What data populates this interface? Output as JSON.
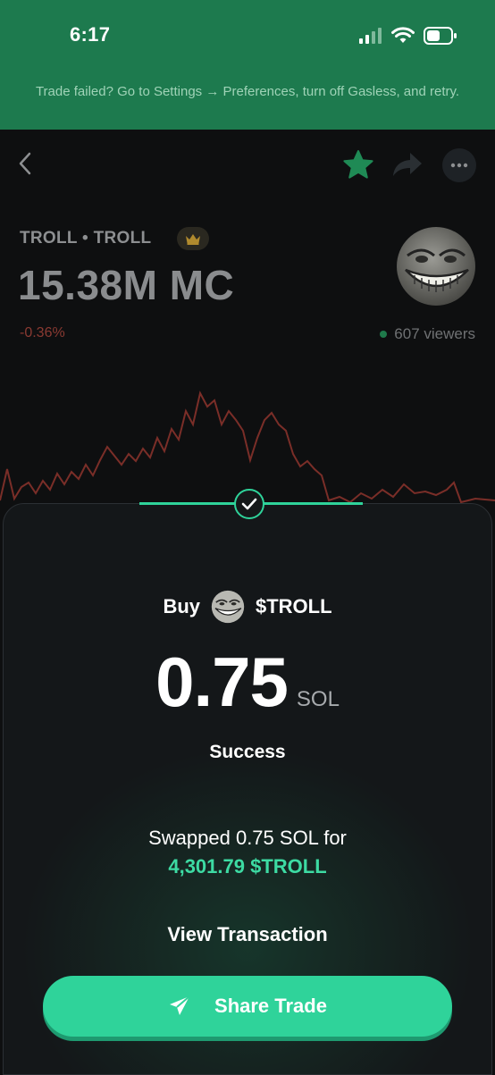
{
  "status_bar": {
    "time": "6:17"
  },
  "banner": {
    "message": "Trade failed? Go to Settings → Preferences, turn off Gasless, and retry."
  },
  "token": {
    "name": "TROLL • TROLL",
    "market_cap": "15.38M MC",
    "change": "-0.36%",
    "viewers": "607 viewers"
  },
  "colors": {
    "banner_bg": "#1d7a4e",
    "accent_green": "#2fd39a",
    "negative_red": "#8a3a32",
    "chart_line": "#7a2e28"
  },
  "icons": {
    "back": "chevron-left-icon",
    "favorite": "star-icon",
    "share": "share-arrow-icon",
    "more": "more-dots-icon",
    "crown": "crown-icon",
    "success": "checkmark-icon",
    "send": "paper-plane-icon"
  },
  "trade": {
    "action": "Buy",
    "symbol": "$TROLL",
    "amount": "0.75",
    "unit": "SOL",
    "status": "Success",
    "swap_text": "Swapped 0.75 SOL for",
    "received": "4,301.79 $TROLL",
    "view_transaction_label": "View Transaction",
    "share_label": "Share Trade"
  }
}
